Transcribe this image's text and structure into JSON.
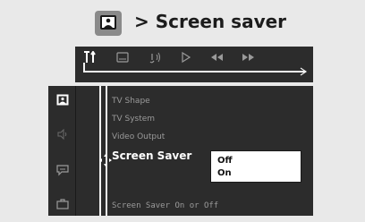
{
  "header": {
    "title": "> Screen saver",
    "icon": "screen-icon"
  },
  "topbar": {
    "tabs": [
      {
        "name": "settings-tab",
        "icon": "settings-icon"
      },
      {
        "name": "subtitle-tab",
        "icon": "subtitle-icon"
      },
      {
        "name": "audio-tab",
        "icon": "audio-icon"
      },
      {
        "name": "play-tab",
        "icon": "play-icon"
      },
      {
        "name": "rewind-tab",
        "icon": "rewind-icon"
      },
      {
        "name": "forward-tab",
        "icon": "forward-icon"
      }
    ]
  },
  "sidebar": {
    "items": [
      {
        "name": "screen-setup",
        "icon": "screen-icon"
      },
      {
        "name": "audio-setup",
        "icon": "speaker-icon"
      },
      {
        "name": "language-setup",
        "icon": "speech-icon"
      },
      {
        "name": "misc-setup",
        "icon": "briefcase-icon"
      }
    ]
  },
  "menu": {
    "items": [
      {
        "label": "TV Shape"
      },
      {
        "label": "TV System"
      },
      {
        "label": "Video Output"
      },
      {
        "label": "Screen Saver"
      }
    ],
    "selected_index": 3
  },
  "dropdown": {
    "options": [
      "Off",
      "On"
    ],
    "selected": "Off"
  },
  "status": {
    "text": "Screen Saver On or Off"
  },
  "colors": {
    "panel": "#2c2c2c",
    "background": "#e9e9e9",
    "dim_text": "#9a9a9a",
    "highlight_text": "#ffffff"
  }
}
